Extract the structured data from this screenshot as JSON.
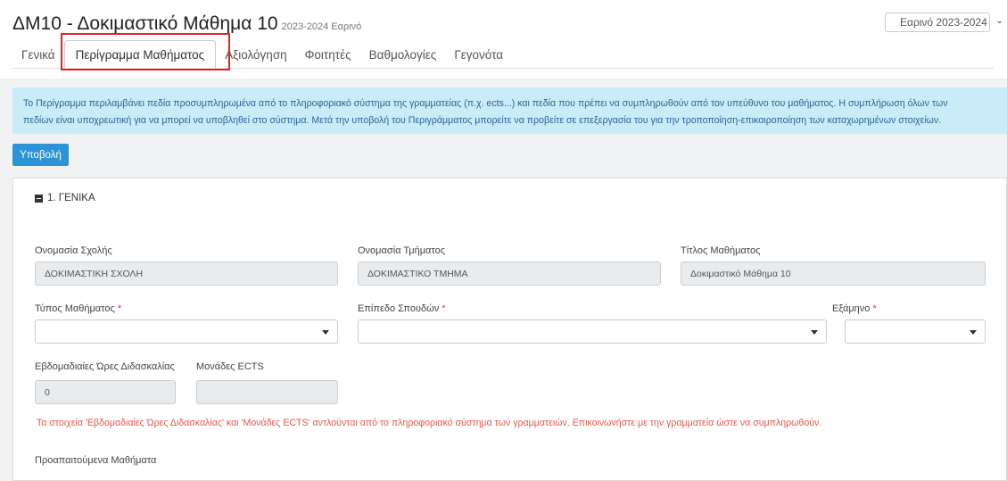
{
  "header": {
    "title": "ΔΜ10 - Δοκιμαστικό Μάθημα 10",
    "period": "2023-2024 Εαρινό",
    "semester_select": "Εαρινό 2023-2024"
  },
  "tabs": [
    {
      "label": "Γενικά"
    },
    {
      "label": "Περίγραμμα Μαθήματος",
      "active": true
    },
    {
      "label": "Αξιολόγηση"
    },
    {
      "label": "Φοιτητές"
    },
    {
      "label": "Βαθμολογίες"
    },
    {
      "label": "Γεγονότα"
    }
  ],
  "info": {
    "line1": "Το Περίγραμμα περιλαμβάνει πεδία προσυμπληρωμένα από το πληροφοριακό σύστημα της γραμματείας (π.χ. ects...) και πεδία που πρέπει να συμπληρωθούν από τον υπεύθυνο του μαθήματος. Η συμπλήρωση όλων των",
    "line2": "πεδίων είναι υποχρεωτική για να μπορεί να υποβληθεί στο σύστημα. Μετά την υποβολή του Περιγράμματος μπορείτε να προβείτε σε επεξεργασία του για την τροποποίηση-επικαιροποίηση των καταχωρημένων στοιχείων."
  },
  "submit_label": "Υποβολή",
  "section": {
    "title": "1. ΓΕΝΙΚΑ",
    "school_label": "Ονομασία Σχολής",
    "school_value": "ΔΟΚΙΜΑΣΤΙΚΗ ΣΧΟΛΗ",
    "dept_label": "Ονομασία Τμήματος",
    "dept_value": "ΔΟΚΙΜΑΣΤΙΚΟ ΤΜΗΜΑ",
    "course_label": "Τίτλος Μαθήματος",
    "course_value": "Δοκιμαστικό Μάθημα 10",
    "type_label": "Τύπος Μαθήματος",
    "level_label": "Επίπεδο Σπουδών",
    "semester_label": "Εξάμηνο",
    "required_mark": "*",
    "hours_label": "Εβδομαδιαίες Ώρες Διδασκαλίας",
    "hours_value": "0",
    "ects_label": "Μονάδες ECTS",
    "ects_value": "",
    "warning": "Τα στοιχεία 'Εβδομαδιαίες Ώρες Διδασκαλίας' και 'Μονάδες ECTS' αντλούνται από το πληροφοριακό σύστημα των γραμματειών. Επικοινωνήστε με την γραμματεία ώστε να συμπληρωθούν.",
    "prereq_label": "Προαπαιτούμενα Μαθήματα"
  },
  "colors": {
    "accent": "#2b93d6",
    "info_bg": "#c9ecf8",
    "warning": "#e8564a",
    "highlight": "#e02323"
  }
}
